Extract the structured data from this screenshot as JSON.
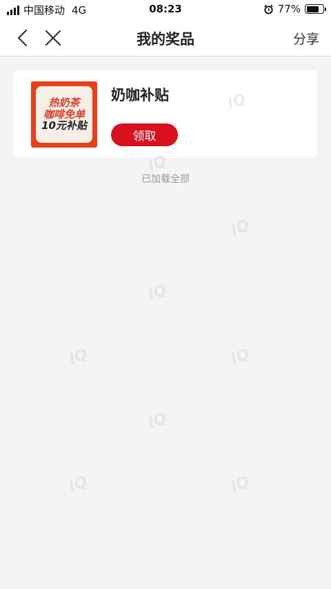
{
  "status_bar": {
    "carrier": "中国移动",
    "network": "4G",
    "time": "08:23",
    "battery": "77%",
    "battery_level": 0.77
  },
  "nav": {
    "title": "我的奖品",
    "share_label": "分享"
  },
  "prize": {
    "thumbnail_lines": [
      "热奶茶",
      "咖啡免单",
      "10元补贴"
    ],
    "name": "奶咖补贴",
    "claim_label": "领取"
  },
  "footer_text": "已加载全部",
  "watermark": "IQ",
  "colors": {
    "accent": "#d8111f",
    "thumb_bg": "#e8401b",
    "page_bg": "#f4f4f4"
  }
}
